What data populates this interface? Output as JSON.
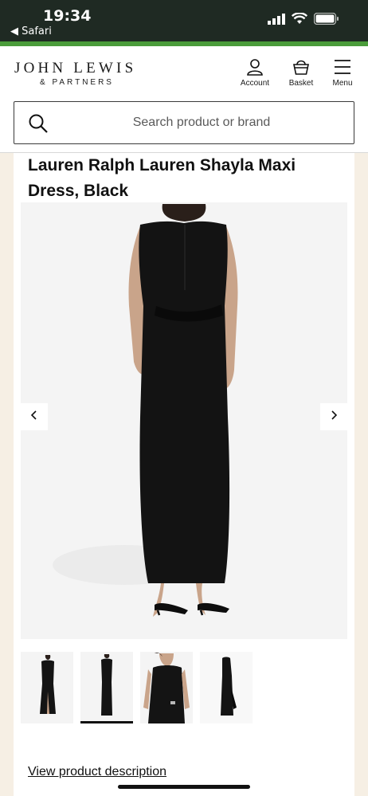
{
  "status_bar": {
    "time": "19:34",
    "back_label": "◀ Safari"
  },
  "header": {
    "logo_main": "JOHN LEWIS",
    "logo_sub": "& PARTNERS",
    "nav": [
      {
        "label": "Account",
        "icon": "account-icon"
      },
      {
        "label": "Basket",
        "icon": "basket-icon"
      },
      {
        "label": "Menu",
        "icon": "menu-icon"
      }
    ]
  },
  "search": {
    "placeholder": "Search product or brand"
  },
  "product": {
    "title": "Lauren Ralph Lauren Shayla Maxi Dress, Black",
    "gallery": {
      "prev_icon": "chevron-left-icon",
      "next_icon": "chevron-right-icon",
      "thumbnail_count": 4,
      "active_thumbnail": 2
    },
    "description_link": "View product description"
  },
  "colors": {
    "status_bar_bg": "#1f2a23",
    "brand_green": "#4a9c3a",
    "page_bg": "#f6efe4"
  }
}
